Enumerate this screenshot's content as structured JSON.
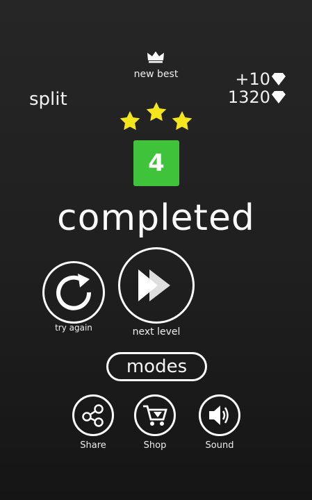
{
  "header": {
    "badge": "new best",
    "mode_name": "split",
    "gems_gained": "+10",
    "gems_total": "1320"
  },
  "result": {
    "stars_earned": 3,
    "stars_total": 3,
    "level": "4",
    "status": "completed"
  },
  "actions": {
    "try_again_label": "try again",
    "next_level_label": "next level",
    "modes_label": "modes",
    "share_label": "Share",
    "shop_label": "Shop",
    "sound_label": "Sound"
  },
  "colors": {
    "level_box": "#3fc33a",
    "star": "#f5e51c",
    "background": "#1f1f1f"
  },
  "icons": [
    "crown-icon",
    "diamond-icon",
    "star-icon",
    "retry-icon",
    "fast-forward-icon",
    "share-icon",
    "cart-icon",
    "speaker-icon"
  ]
}
